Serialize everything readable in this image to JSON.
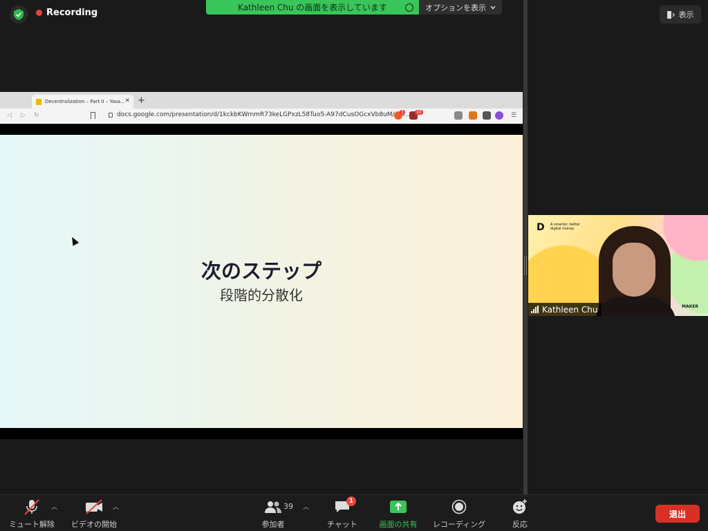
{
  "top": {
    "recording_label": "Recording",
    "share_banner": "Kathleen Chu の画面を表示しています",
    "options_label": "オプションを表示",
    "show_label": "表示"
  },
  "browser": {
    "tab_title": "Decentralization – Part II – Yasa...",
    "new_tab": "+",
    "url": "docs.google.com/presentation/d/1kckbKWrnmR73keLGPxzL58Tuo5-A97dCusOGcxVb8uM/edi...",
    "ext_badge_1": "3",
    "ext_badge_2": "10"
  },
  "slide": {
    "title": "次のステップ",
    "subtitle": "段階的分散化"
  },
  "video": {
    "participant_name": "Kathleen Chu",
    "logo_mark": "D",
    "logo_tagline": "A smarter, better digital money",
    "brand": "MAKER"
  },
  "toolbar": {
    "mute": "ミュート解除",
    "video": "ビデオの開始",
    "participants": "参加者",
    "participant_count": "39",
    "chat": "チャット",
    "chat_badge": "1",
    "share": "画面の共有",
    "record": "レコーディング",
    "reactions": "反応",
    "leave": "退出"
  },
  "colors": {
    "share_green": "#3ac55a",
    "record_red": "#e8453c",
    "leave_red": "#d93025"
  }
}
